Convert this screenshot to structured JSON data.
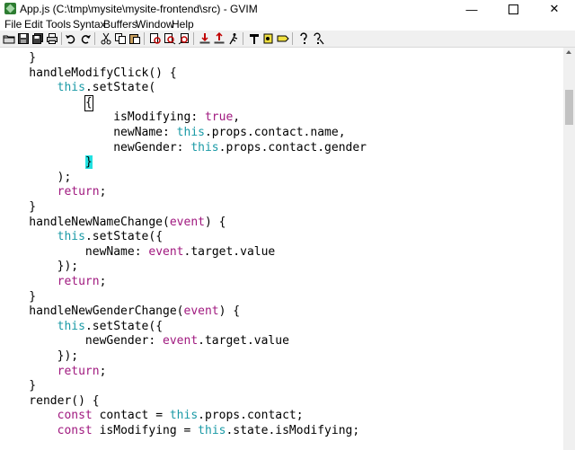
{
  "window": {
    "title": "App.js (C:\\tmp\\mysite\\mysite-frontend\\src) - GVIM",
    "controls": {
      "minimize": "—",
      "maximize": "",
      "close": "✕"
    }
  },
  "menu": [
    "File",
    "Edit",
    "Tools",
    "Syntax",
    "Buffers",
    "Window",
    "Help"
  ],
  "toolbar": [
    "open-icon",
    "save-icon",
    "save-all-icon",
    "print-icon",
    "undo-icon",
    "redo-icon",
    "cut-icon",
    "copy-icon",
    "paste-icon",
    "find-icon",
    "find-next-icon",
    "find-prev-icon",
    "load-session-icon",
    "save-session-icon",
    "run-script-icon",
    "make-icon",
    "run-ctags-icon",
    "jump-tag-icon",
    "help-icon",
    "find-help-icon"
  ],
  "editor": {
    "lines": [
      [
        [
          "    }",
          ""
        ]
      ],
      [
        [
          "    handleModifyClick() {",
          ""
        ]
      ],
      [
        [
          "        ",
          ""
        ],
        [
          "this",
          "kw"
        ],
        [
          ".setState(",
          ""
        ]
      ],
      [
        [
          "            ",
          ""
        ],
        [
          "{",
          "cursor"
        ]
      ],
      [
        [
          "                isModifying: ",
          ""
        ],
        [
          "true",
          "kw2"
        ],
        [
          ",",
          ""
        ]
      ],
      [
        [
          "                newName: ",
          ""
        ],
        [
          "this",
          "kw"
        ],
        [
          ".props.contact.name,",
          ""
        ]
      ],
      [
        [
          "                newGender: ",
          ""
        ],
        [
          "this",
          "kw"
        ],
        [
          ".props.contact.gender",
          ""
        ]
      ],
      [
        [
          "            ",
          ""
        ],
        [
          "}",
          "match"
        ]
      ],
      [
        [
          "        );",
          ""
        ]
      ],
      [
        [
          "        ",
          ""
        ],
        [
          "return",
          "kw2"
        ],
        [
          ";",
          ""
        ]
      ],
      [
        [
          "    }",
          ""
        ]
      ],
      [
        [
          "    handleNewNameChange(",
          ""
        ],
        [
          "event",
          "kw2"
        ],
        [
          ") {",
          ""
        ]
      ],
      [
        [
          "        ",
          ""
        ],
        [
          "this",
          "kw"
        ],
        [
          ".setState({",
          ""
        ]
      ],
      [
        [
          "            newName: ",
          ""
        ],
        [
          "event",
          "kw2"
        ],
        [
          ".target.value",
          ""
        ]
      ],
      [
        [
          "        });",
          ""
        ]
      ],
      [
        [
          "        ",
          ""
        ],
        [
          "return",
          "kw2"
        ],
        [
          ";",
          ""
        ]
      ],
      [
        [
          "    }",
          ""
        ]
      ],
      [
        [
          "    handleNewGenderChange(",
          ""
        ],
        [
          "event",
          "kw2"
        ],
        [
          ") {",
          ""
        ]
      ],
      [
        [
          "        ",
          ""
        ],
        [
          "this",
          "kw"
        ],
        [
          ".setState({",
          ""
        ]
      ],
      [
        [
          "            newGender: ",
          ""
        ],
        [
          "event",
          "kw2"
        ],
        [
          ".target.value",
          ""
        ]
      ],
      [
        [
          "        });",
          ""
        ]
      ],
      [
        [
          "        ",
          ""
        ],
        [
          "return",
          "kw2"
        ],
        [
          ";",
          ""
        ]
      ],
      [
        [
          "    }",
          ""
        ]
      ],
      [
        [
          "    render() {",
          ""
        ]
      ],
      [
        [
          "        ",
          ""
        ],
        [
          "const",
          "kw2"
        ],
        [
          " contact = ",
          ""
        ],
        [
          "this",
          "kw"
        ],
        [
          ".props.contact;",
          ""
        ]
      ],
      [
        [
          "        ",
          ""
        ],
        [
          "const",
          "kw2"
        ],
        [
          " isModifying = ",
          ""
        ],
        [
          "this",
          "kw"
        ],
        [
          ".state.isModifying;",
          ""
        ]
      ]
    ]
  },
  "colors": {
    "keyword_this": "#1a9aa6",
    "keyword_other": "#a0197f",
    "cursor_match": "#22e1e1"
  }
}
